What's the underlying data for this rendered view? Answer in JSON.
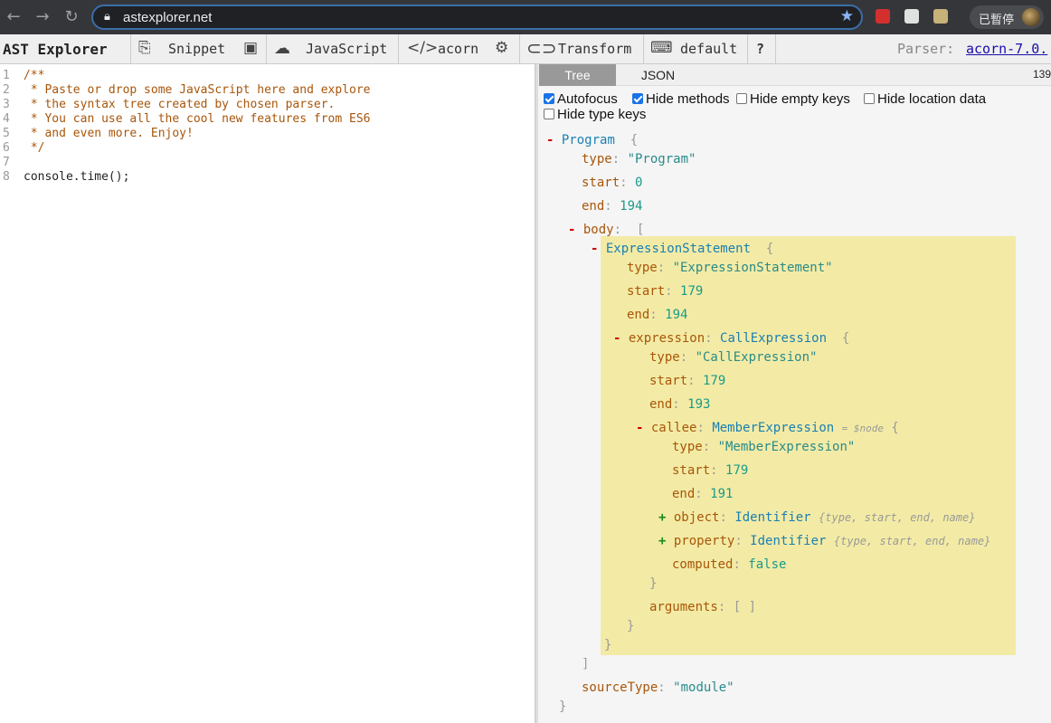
{
  "browser": {
    "url": "astexplorer.net",
    "profile_label": "已暫停"
  },
  "toolbar": {
    "title": "AST Explorer",
    "snippet": "Snippet",
    "language": "JavaScript",
    "parser": "acorn",
    "transform": "Transform",
    "keymap": "default",
    "help": "?",
    "parser_label": "Parser:",
    "parser_version": "acorn-7.0."
  },
  "editor": {
    "lines": [
      {
        "num": "1",
        "text": "/**"
      },
      {
        "num": "2",
        "text": " * Paste or drop some JavaScript here and explore"
      },
      {
        "num": "3",
        "text": " * the syntax tree created by chosen parser."
      },
      {
        "num": "4",
        "text": " * You can use all the cool new features from ES6"
      },
      {
        "num": "5",
        "text": " * and even more. Enjoy!"
      },
      {
        "num": "6",
        "text": " */"
      },
      {
        "num": "7",
        "text": ""
      },
      {
        "num": "8",
        "text": "console.time();"
      }
    ]
  },
  "output": {
    "tabs": {
      "tree": "Tree",
      "json": "JSON"
    },
    "time_ms": "139",
    "options": [
      {
        "label": "Autofocus",
        "checked": true
      },
      {
        "label": "Hide methods",
        "checked": true
      },
      {
        "label": "Hide empty keys",
        "checked": false
      },
      {
        "label": "Hide location data",
        "checked": false
      },
      {
        "label": "Hide type keys",
        "checked": false
      }
    ],
    "tree": {
      "program": "Program",
      "program_type": "\"Program\"",
      "program_start": "0",
      "program_end": "194",
      "body_key": "body",
      "stmt": "ExpressionStatement",
      "stmt_type": "\"ExpressionStatement\"",
      "stmt_start": "179",
      "stmt_end": "194",
      "expression_key": "expression",
      "call": "CallExpression",
      "call_type": "\"CallExpression\"",
      "call_start": "179",
      "call_end": "193",
      "callee_key": "callee",
      "member": "MemberExpression",
      "node_annot": "= $node",
      "member_type": "\"MemberExpression\"",
      "member_start": "179",
      "member_end": "191",
      "object_key": "object",
      "object_type": "Identifier",
      "object_summary": "{type, start, end, name}",
      "property_key": "property",
      "property_type": "Identifier",
      "property_summary": "{type, start, end, name}",
      "computed_key": "computed",
      "computed_val": "false",
      "arguments_key": "arguments",
      "arguments_val": "[ ]",
      "source_type_key": "sourceType",
      "source_type_val": "\"module\"",
      "k_type": "type",
      "k_start": "start",
      "k_end": "end"
    }
  }
}
